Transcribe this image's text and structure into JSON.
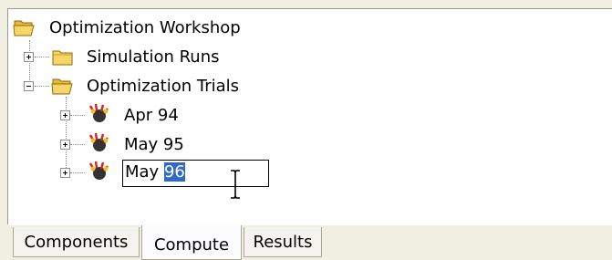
{
  "tree": {
    "root": {
      "label": "Optimization Workshop",
      "icon": "folder-open-icon"
    },
    "children": [
      {
        "label": "Simulation Runs",
        "icon": "folder-closed-icon",
        "expander": "plus"
      },
      {
        "label": "Optimization Trials",
        "icon": "folder-open-icon",
        "expander": "minus",
        "children": [
          {
            "label": "Apr 94",
            "icon": "trial-icon",
            "expander": "plus"
          },
          {
            "label": "May 95",
            "icon": "trial-icon",
            "expander": "plus"
          },
          {
            "label": "May 96",
            "icon": "trial-icon",
            "expander": "plus",
            "editing": true,
            "edit_prefix": "May ",
            "edit_selected": "96"
          }
        ]
      }
    ]
  },
  "tabs": [
    {
      "label": "Components",
      "active": false
    },
    {
      "label": "Compute",
      "active": true
    },
    {
      "label": "Results",
      "active": false
    }
  ],
  "colors": {
    "selection": "#316ac5",
    "folder": "#f0c850",
    "window_bg": "#f1efe2"
  }
}
